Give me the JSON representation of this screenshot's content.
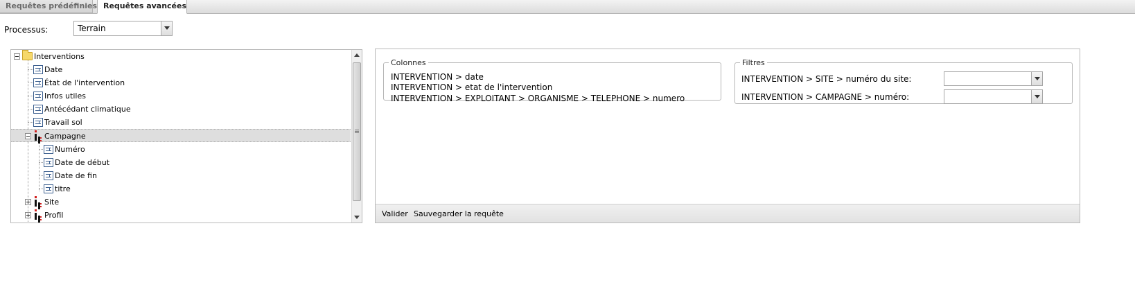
{
  "tabs": [
    {
      "label": "Requêtes prédéfinies",
      "active": false
    },
    {
      "label": "Requêtes avancées",
      "active": true
    }
  ],
  "processus": {
    "label": "Processus:",
    "selected": "Terrain"
  },
  "tree": {
    "root": {
      "label": "Interventions",
      "icon": "folder-icon",
      "expanded": true
    },
    "items": [
      {
        "label": "Date",
        "icon": "field-icon"
      },
      {
        "label": "État de l'intervention",
        "icon": "field-icon"
      },
      {
        "label": "Infos utiles",
        "icon": "field-icon"
      },
      {
        "label": "Antécédant climatique",
        "icon": "field-icon"
      },
      {
        "label": "Travail sol",
        "icon": "field-icon"
      },
      {
        "label": "Campagne",
        "icon": "entity-icon",
        "expanded": true,
        "selected": true
      },
      {
        "label": "Numéro",
        "icon": "field-icon"
      },
      {
        "label": "Date de début",
        "icon": "field-icon"
      },
      {
        "label": "Date de fin",
        "icon": "field-icon"
      },
      {
        "label": "titre",
        "icon": "field-icon"
      },
      {
        "label": "Site",
        "icon": "entity-icon",
        "expanded": false
      },
      {
        "label": "Profil",
        "icon": "entity-icon",
        "expanded": false
      }
    ]
  },
  "colonnes": {
    "legend": "Colonnes",
    "lines": [
      "INTERVENTION > date",
      "INTERVENTION > etat de l'intervention",
      "INTERVENTION > EXPLOITANT > ORGANISME > TELEPHONE > numero"
    ]
  },
  "filtres": {
    "legend": "Filtres",
    "rows": [
      {
        "label": "INTERVENTION > SITE > numéro du site:",
        "value": ""
      },
      {
        "label": "INTERVENTION > CAMPAGNE > numéro:",
        "value": ""
      }
    ]
  },
  "toolbar": {
    "valider": "Valider",
    "sauvegarder": "Sauvegarder la requête"
  }
}
